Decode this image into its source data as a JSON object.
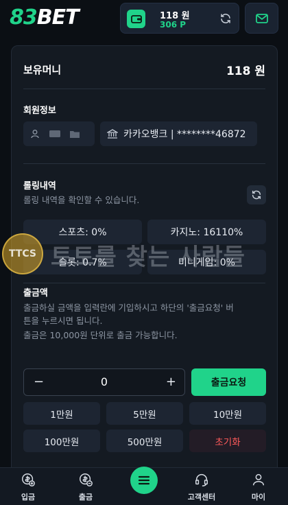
{
  "header": {
    "logo_num": "83",
    "logo_text": "BET",
    "wallet_amount": "118 원",
    "wallet_points": "306 P"
  },
  "balance": {
    "label": "보유머니",
    "value": "118 원"
  },
  "member": {
    "title": "회원정보",
    "bank": "카카오뱅크 | ********46872"
  },
  "rolling": {
    "title": "롤링내역",
    "desc": "롤링 내역을 확인할 수 있습니다.",
    "stats": [
      "스포츠: 0%",
      "카지노: 16110%",
      "슬롯: 0.7%",
      "미니게임: 0%"
    ]
  },
  "watermark": {
    "logo": "TTCS",
    "text": "토토를 찾는 사람들"
  },
  "withdraw": {
    "title": "출금액",
    "desc1": "출금하실 금액을 입력란에 기입하시고 하단의 '출금요청' 버",
    "desc2": "튼을 누르시면 됩니다.",
    "desc3": "출금은 10,000원 단위로 출금 가능합니다.",
    "amount": "0",
    "minus": "−",
    "plus": "+",
    "request_label": "출금요청",
    "quick": [
      "1만원",
      "5만원",
      "10만원",
      "100만원",
      "500만원"
    ],
    "reset": "초기화"
  },
  "nav": {
    "deposit": "입금",
    "withdraw": "출금",
    "support": "고객센터",
    "my": "마이"
  },
  "colors": {
    "accent": "#20d38a",
    "background": "#0b0f14",
    "panel": "#141a22",
    "reset_red": "#ff5a5a"
  }
}
